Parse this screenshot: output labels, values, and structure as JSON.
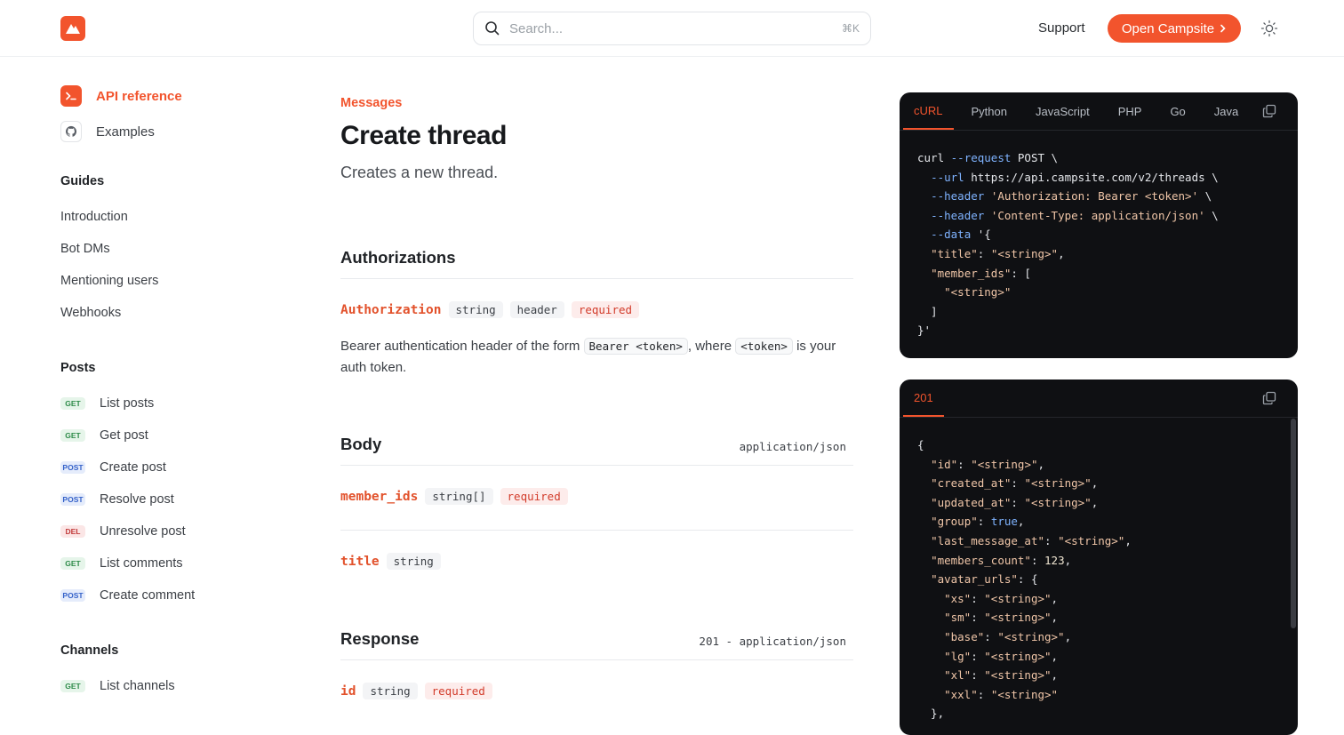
{
  "header": {
    "search_placeholder": "Search...",
    "search_shortcut": "⌘K",
    "support_label": "Support",
    "open_button_label": "Open Campsite",
    "accent": "#f2542d"
  },
  "sidebar": {
    "top_links": [
      {
        "label": "API reference",
        "icon": "terminal-icon",
        "active": true
      },
      {
        "label": "Examples",
        "icon": "github-icon",
        "active": false
      }
    ],
    "guides_heading": "Guides",
    "guides": [
      "Introduction",
      "Bot DMs",
      "Mentioning users",
      "Webhooks"
    ],
    "posts_heading": "Posts",
    "posts": [
      {
        "method": "GET",
        "label": "List posts"
      },
      {
        "method": "GET",
        "label": "Get post"
      },
      {
        "method": "POST",
        "label": "Create post"
      },
      {
        "method": "POST",
        "label": "Resolve post"
      },
      {
        "method": "DEL",
        "label": "Unresolve post"
      },
      {
        "method": "GET",
        "label": "List comments"
      },
      {
        "method": "POST",
        "label": "Create comment"
      }
    ],
    "channels_heading": "Channels",
    "channels": [
      {
        "method": "GET",
        "label": "List channels"
      }
    ]
  },
  "main": {
    "breadcrumb": "Messages",
    "title": "Create thread",
    "subtitle": "Creates a new thread.",
    "authorizations": {
      "heading": "Authorizations",
      "param": {
        "name": "Authorization",
        "type": "string",
        "location": "header",
        "required": "required"
      },
      "desc_before": "Bearer authentication header of the form ",
      "desc_code1": "Bearer <token>",
      "desc_middle": ", where ",
      "desc_code2": "<token>",
      "desc_after": " is your auth token."
    },
    "body": {
      "heading": "Body",
      "content_type": "application/json",
      "params": [
        {
          "name": "member_ids",
          "type": "string[]",
          "required": "required"
        },
        {
          "name": "title",
          "type": "string",
          "required": ""
        }
      ]
    },
    "response": {
      "heading": "Response",
      "content_type": "201 - application/json",
      "params": [
        {
          "name": "id",
          "type": "string",
          "required": "required"
        }
      ]
    }
  },
  "request_panel": {
    "tabs": [
      "cURL",
      "Python",
      "JavaScript",
      "PHP",
      "Go",
      "Java"
    ],
    "active_tab": "cURL",
    "lines": [
      "curl --request POST \\",
      "  --url https://api.campsite.com/v2/threads \\",
      "  --header 'Authorization: Bearer <token>' \\",
      "  --header 'Content-Type: application/json' \\",
      "  --data '{",
      "  \"title\": \"<string>\",",
      "  \"member_ids\": [",
      "    \"<string>\"",
      "  ]",
      "}'"
    ]
  },
  "response_panel": {
    "tabs": [
      "201"
    ],
    "active_tab": "201",
    "lines": [
      "{",
      "  \"id\": \"<string>\",",
      "  \"created_at\": \"<string>\",",
      "  \"updated_at\": \"<string>\",",
      "  \"group\": true,",
      "  \"last_message_at\": \"<string>\",",
      "  \"members_count\": 123,",
      "  \"avatar_urls\": {",
      "    \"xs\": \"<string>\",",
      "    \"sm\": \"<string>\",",
      "    \"base\": \"<string>\",",
      "    \"lg\": \"<string>\",",
      "    \"xl\": \"<string>\",",
      "    \"xxl\": \"<string>\"",
      "  },"
    ]
  }
}
